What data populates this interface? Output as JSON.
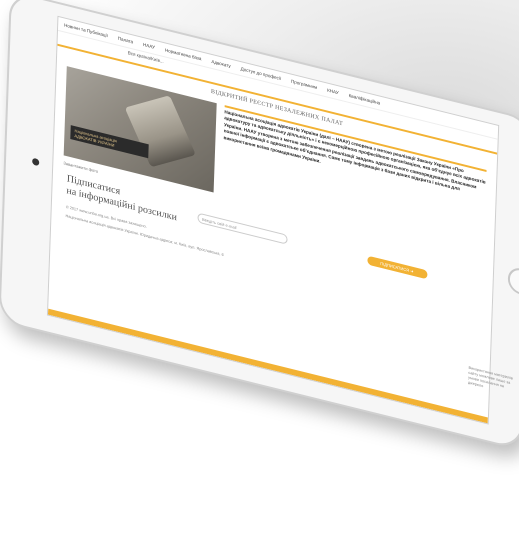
{
  "nav": {
    "items": [
      "Новини та Публікації",
      "Палата",
      "НААУ",
      "Нормативна база",
      "Адвокату",
      "Доступ до професії",
      "Програмним",
      "КНАУ",
      "Кваліфікаційна"
    ]
  },
  "sub_nav": {
    "label": "Вся країна/Київ..."
  },
  "page": {
    "section_title": "ВІДКРИТИЙ РЕЄСТР НЕЗАЛЕЖНИХ ПАЛАТ",
    "photo_label_line1": "Національна асоціація",
    "photo_label_line2": "АДВОКАТІВ УКРАЇНИ",
    "photo_caption": "Завантажити фото",
    "article_text": "Національна асоціація адвокатів України (далі – НААУ) створена з метою реалізації Закону України «Про адвокатуру та адвокатську діяльність» і є некомерційною професійною організацією, яка об’єднує всіх адвокатів України. НААУ утворена з метою забезпечення реалізації завдань адвокатського самоврядування. Власником повної інформації є адвокатське об’єднання. Саме тому інформація з бази даних відкрита і вільна для використання всіма громадянами України."
  },
  "subscribe": {
    "title_line1": "Підписатися",
    "title_line2": "на інформаційні розсилки",
    "email_placeholder": "Введіть свій e-mail",
    "button_label": "ПІДПИСАТИСЯ ➜"
  },
  "footer": {
    "line1": "© 2017 www.unba.org.ua. Всі права захищено.",
    "line2": "Національна асоціація адвокатів України. Юридична адреса: м. Київ, вул. Ярославська, 6",
    "side_text": "Використання матеріалів сайту можливе лише за умови посилання на джерело"
  },
  "colors": {
    "accent": "#f2b234"
  },
  "icons": {
    "camera": "camera-icon",
    "home": "home-button-icon"
  }
}
